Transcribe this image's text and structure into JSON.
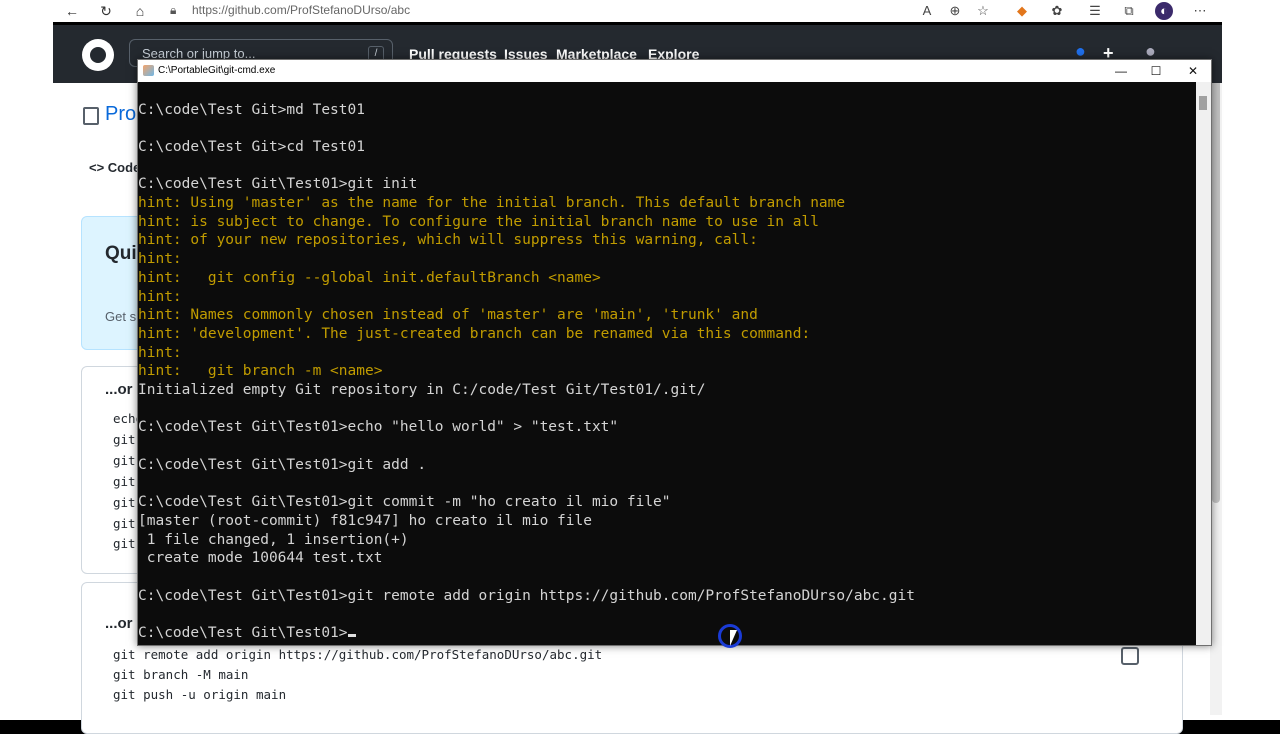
{
  "browser": {
    "url": "https://github.com/ProfStefanoDUrso/abc"
  },
  "github": {
    "search_placeholder": "Search or jump to...",
    "search_key": "/",
    "nav": [
      "Pull requests",
      "Issues",
      "Marketplace",
      "Explore"
    ],
    "repo_title": "Pro",
    "code_tab": "Code",
    "quick_title": "Qui",
    "quick_sub": "Get s",
    "section1_title": "...or",
    "section1_lines": [
      "echo",
      "git",
      "git",
      "git",
      "git",
      "git",
      "git"
    ],
    "section2_title": "...or",
    "section2_lines": [
      "git remote add origin https://github.com/ProfStefanoDUrso/abc.git",
      "git branch -M main",
      "git push -u origin main"
    ]
  },
  "terminal": {
    "title": "C:\\PortableGit\\git-cmd.exe",
    "controls": [
      "—",
      "☐",
      "✕"
    ],
    "lines": [
      {
        "t": "cmd",
        "text": "C:\\code\\Test Git>md Test01"
      },
      {
        "t": "cmd",
        "text": ""
      },
      {
        "t": "cmd",
        "text": "C:\\code\\Test Git>cd Test01"
      },
      {
        "t": "cmd",
        "text": ""
      },
      {
        "t": "cmd",
        "text": "C:\\code\\Test Git\\Test01>git init"
      },
      {
        "t": "hint",
        "text": "hint: Using 'master' as the name for the initial branch. This default branch name"
      },
      {
        "t": "hint",
        "text": "hint: is subject to change. To configure the initial branch name to use in all"
      },
      {
        "t": "hint",
        "text": "hint: of your new repositories, which will suppress this warning, call:"
      },
      {
        "t": "hint",
        "text": "hint:"
      },
      {
        "t": "hint",
        "text": "hint:   git config --global init.defaultBranch <name>"
      },
      {
        "t": "hint",
        "text": "hint:"
      },
      {
        "t": "hint",
        "text": "hint: Names commonly chosen instead of 'master' are 'main', 'trunk' and"
      },
      {
        "t": "hint",
        "text": "hint: 'development'. The just-created branch can be renamed via this command:"
      },
      {
        "t": "hint",
        "text": "hint:"
      },
      {
        "t": "hint",
        "text": "hint:   git branch -m <name>"
      },
      {
        "t": "cmd",
        "text": "Initialized empty Git repository in C:/code/Test Git/Test01/.git/"
      },
      {
        "t": "cmd",
        "text": ""
      },
      {
        "t": "cmd",
        "text": "C:\\code\\Test Git\\Test01>echo \"hello world\" > \"test.txt\""
      },
      {
        "t": "cmd",
        "text": ""
      },
      {
        "t": "cmd",
        "text": "C:\\code\\Test Git\\Test01>git add ."
      },
      {
        "t": "cmd",
        "text": ""
      },
      {
        "t": "cmd",
        "text": "C:\\code\\Test Git\\Test01>git commit -m \"ho creato il mio file\""
      },
      {
        "t": "cmd",
        "text": "[master (root-commit) f81c947] ho creato il mio file"
      },
      {
        "t": "cmd",
        "text": " 1 file changed, 1 insertion(+)"
      },
      {
        "t": "cmd",
        "text": " create mode 100644 test.txt"
      },
      {
        "t": "cmd",
        "text": ""
      },
      {
        "t": "cmd",
        "text": "C:\\code\\Test Git\\Test01>git remote add origin https://github.com/ProfStefanoDUrso/abc.git"
      },
      {
        "t": "cmd",
        "text": ""
      },
      {
        "t": "cmd",
        "text": "C:\\code\\Test Git\\Test01>"
      }
    ]
  }
}
